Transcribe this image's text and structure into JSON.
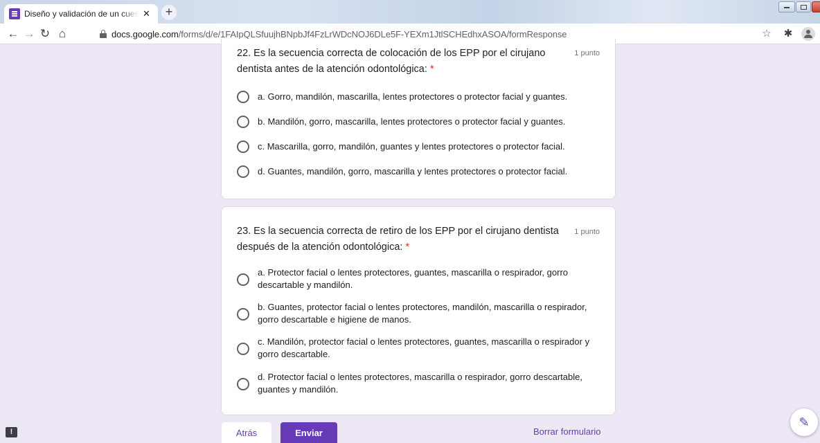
{
  "browser": {
    "tab_title": "Diseño y validación de un cuestio",
    "tab_close": "✕",
    "new_tab": "+",
    "url_domain": "docs.google.com",
    "url_path": "/forms/d/e/1FAIpQLSfuujhBNpbJf4FzLrWDcNOJ6DLe5F-YEXm1JtlSCHEdhxASOA/formResponse",
    "icons": {
      "back": "arrow-left-icon",
      "forward": "arrow-right-icon",
      "reload": "reload-icon",
      "home": "home-icon",
      "lock": "lock-icon",
      "star": "star-icon",
      "extensions": "puzzle-icon",
      "profile": "profile-icon"
    }
  },
  "form": {
    "accent_color": "#673ab7",
    "background_color": "#ede7f6",
    "questions": [
      {
        "title": "22. Es la secuencia correcta de colocación de los EPP por el cirujano dentista antes de la atención odontológica:",
        "required_mark": "*",
        "points": "1 punto",
        "options": [
          "a. Gorro, mandilón, mascarilla, lentes protectores o protector facial y guantes.",
          "b. Mandilón, gorro, mascarilla, lentes protectores o protector facial y guantes.",
          "c. Mascarilla, gorro, mandilón, guantes y lentes protectores o protector facial.",
          "d. Guantes, mandilón, gorro, mascarilla y lentes protectores o protector facial."
        ]
      },
      {
        "title": "23. Es la secuencia correcta de retiro de los EPP por el cirujano dentista después de la atención odontológica:",
        "required_mark": "*",
        "points": "1 punto",
        "options": [
          "a. Protector facial o lentes protectores, guantes, mascarilla o respirador, gorro descartable y mandilón.",
          "b. Guantes, protector facial o lentes protectores, mandilón, mascarilla o respirador, gorro descartable e higiene de manos.",
          "c. Mandilón, protector facial o lentes protectores, guantes, mascarilla o respirador y gorro descartable.",
          "d. Protector facial o lentes protectores, mascarilla o respirador, gorro descartable, guantes y mandilón."
        ]
      }
    ],
    "buttons": {
      "back": "Atrás",
      "submit": "Enviar",
      "clear": "Borrar formulario"
    },
    "feedback_icon": "feedback-icon",
    "edit_icon": "pencil-icon"
  }
}
